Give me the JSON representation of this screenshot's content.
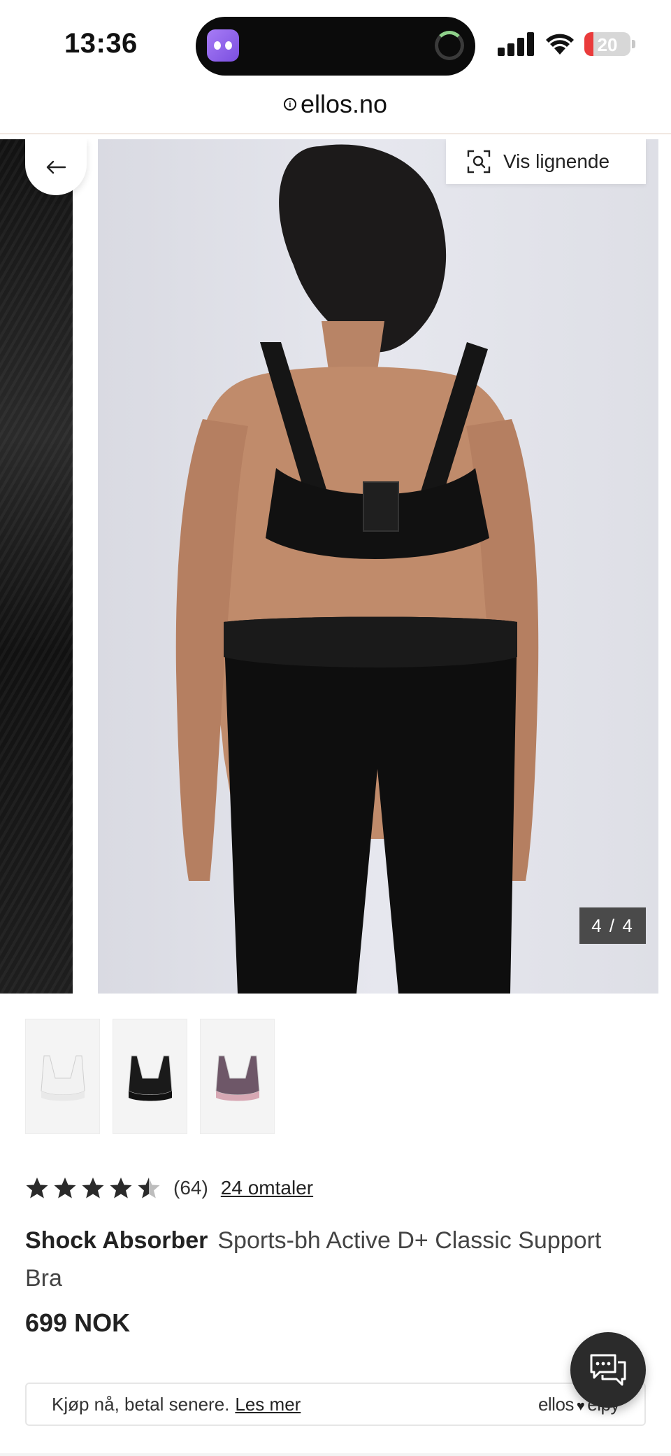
{
  "status_bar": {
    "time": "13:36",
    "battery_level": "20",
    "battery_fraction": 0.2,
    "battery_color": "#ea3b3b"
  },
  "browser": {
    "url": "ellos.no"
  },
  "gallery": {
    "similar_button_label": "Vis lignende",
    "image_counter": "4 / 4",
    "thumbnails": [
      {
        "color_name": "white",
        "color": "#f2f2f2",
        "band": "#e9e9e9"
      },
      {
        "color_name": "black",
        "color": "#1a1a1a",
        "band": "#111111"
      },
      {
        "color_name": "purple",
        "color": "#6e5768",
        "band": "#d7a8b4"
      }
    ]
  },
  "product": {
    "rating_value": 4.5,
    "rating_count": "(64)",
    "reviews_link": "24 omtaler",
    "brand": "Shock Absorber",
    "name": "Sports-bh Active D+ Classic Support Bra",
    "price": "699 NOK"
  },
  "payment": {
    "text": "Kjøp nå, betal senere.",
    "link": "Les mer",
    "logo_left": "ellos",
    "logo_right": "elpy"
  },
  "colors": {
    "dark": "#2b2b2b",
    "counter_bg": "#4a4a4a"
  }
}
